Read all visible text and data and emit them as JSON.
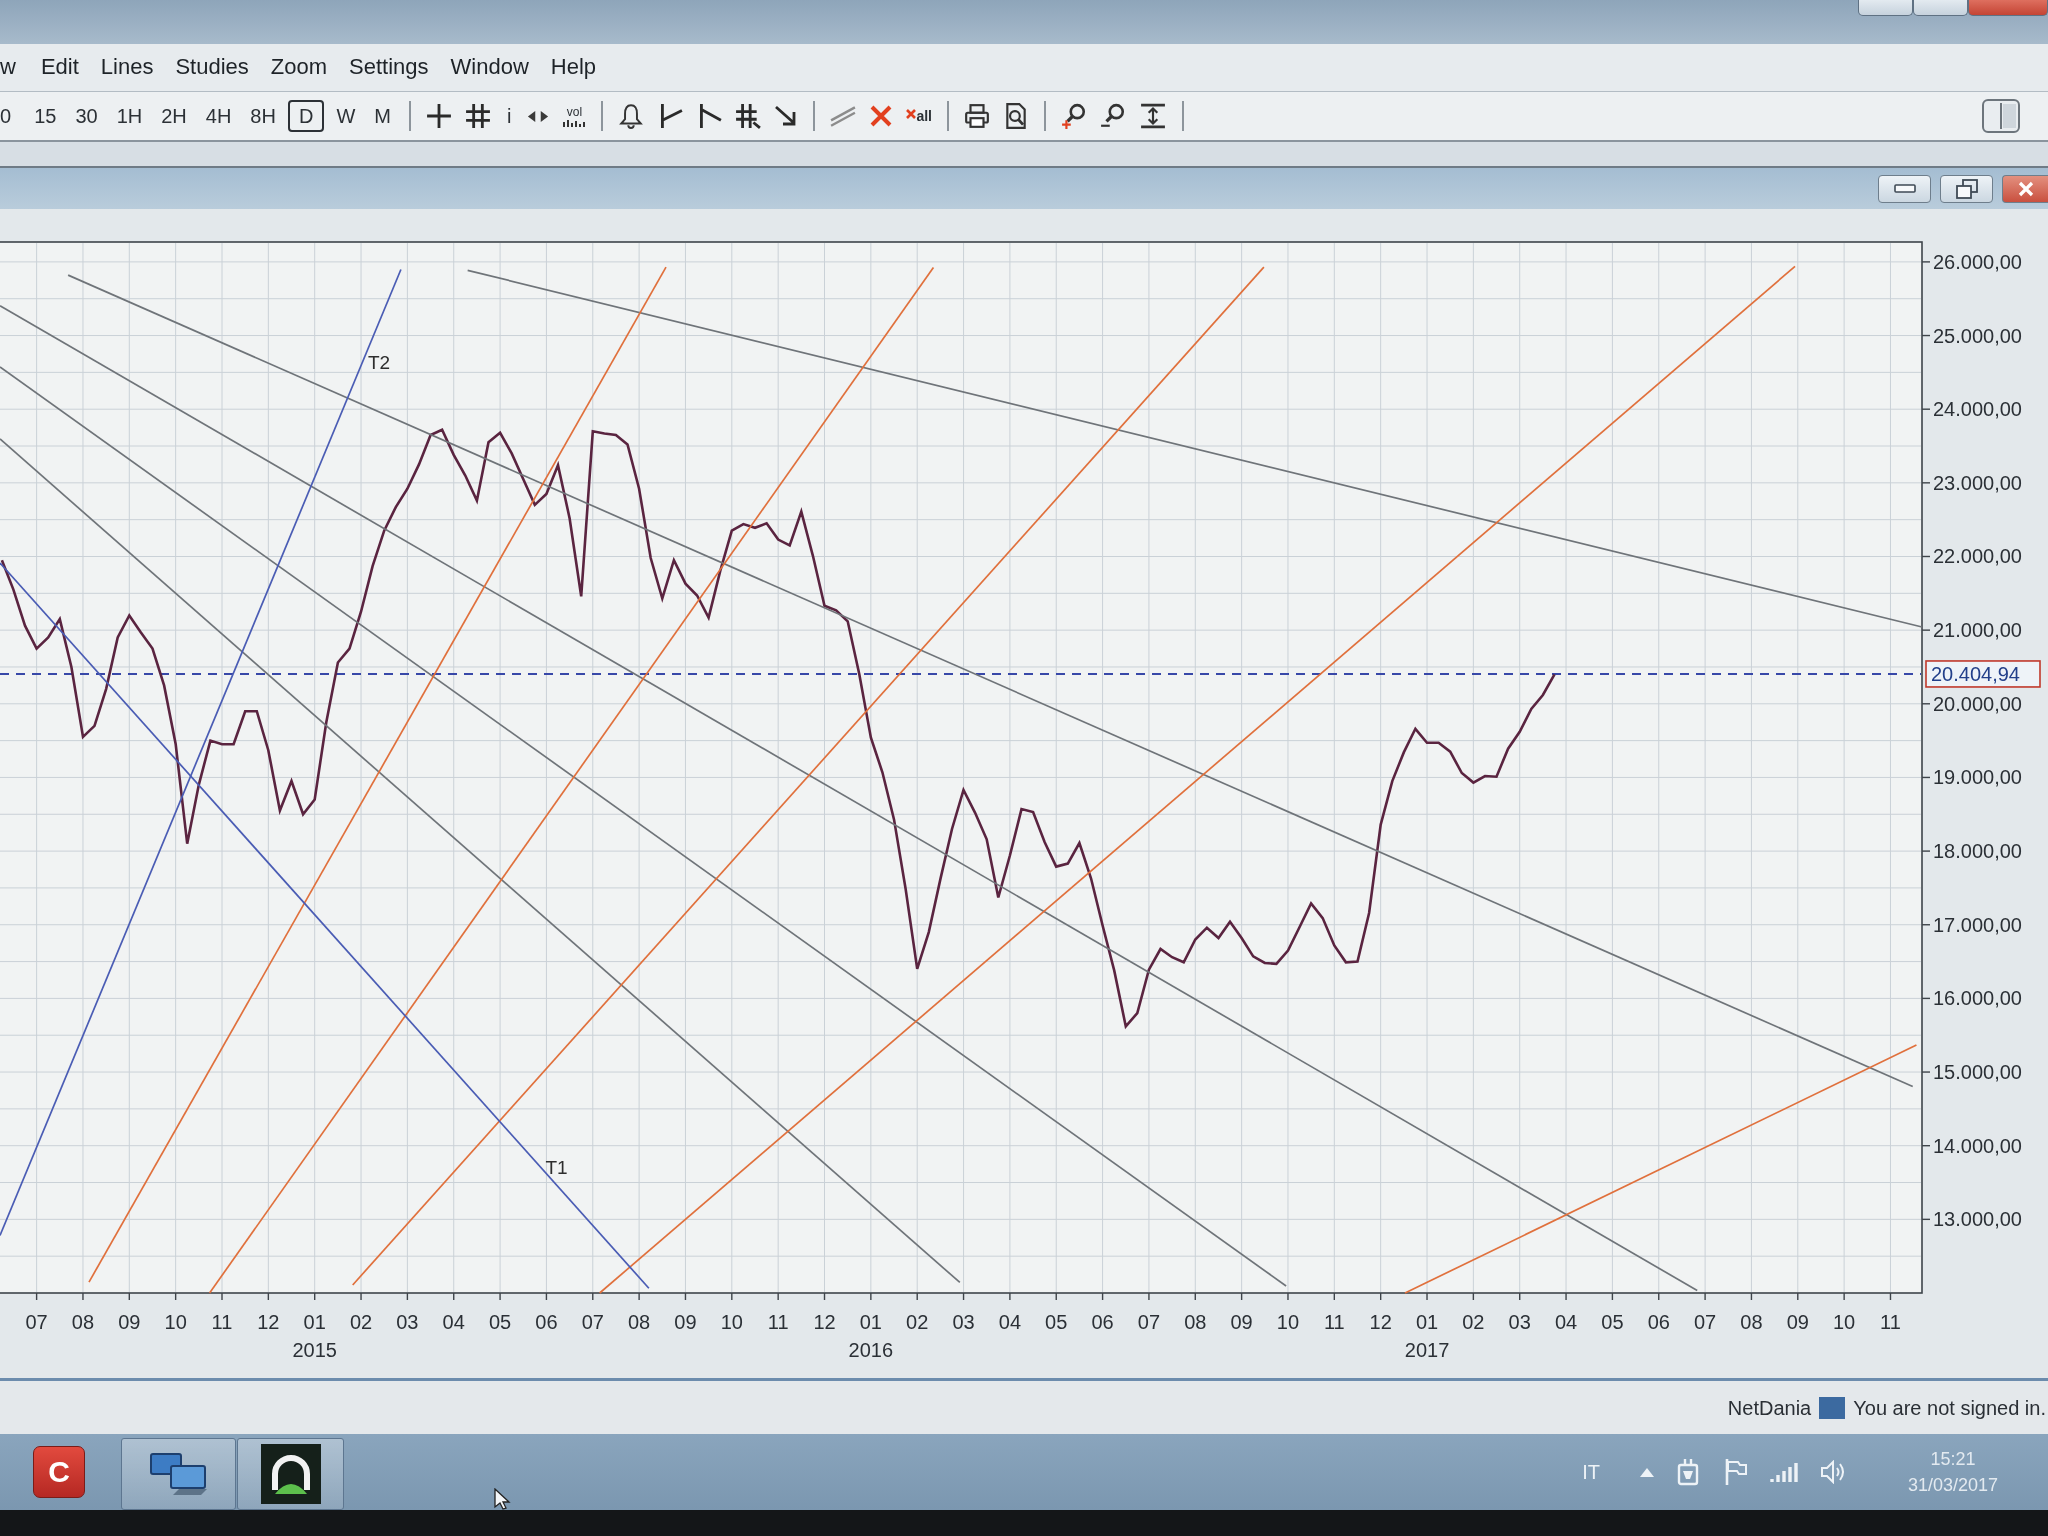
{
  "menu": [
    "w",
    "Edit",
    "Lines",
    "Studies",
    "Zoom",
    "Settings",
    "Window",
    "Help"
  ],
  "toolbar": [
    {
      "kind": "period",
      "label": "0",
      "selected": false
    },
    {
      "kind": "period",
      "label": "15",
      "selected": false
    },
    {
      "kind": "period",
      "label": "30",
      "selected": false
    },
    {
      "kind": "period",
      "label": "1H",
      "selected": false
    },
    {
      "kind": "period",
      "label": "2H",
      "selected": false
    },
    {
      "kind": "period",
      "label": "4H",
      "selected": false
    },
    {
      "kind": "period",
      "label": "8H",
      "selected": false
    },
    {
      "kind": "period",
      "label": "D",
      "selected": true
    },
    {
      "kind": "period",
      "label": "W",
      "selected": false
    },
    {
      "kind": "period",
      "label": "M",
      "selected": false
    },
    {
      "kind": "separator"
    },
    {
      "kind": "crosshair"
    },
    {
      "kind": "hash"
    },
    {
      "kind": "info",
      "label": "i"
    },
    {
      "kind": "arrows"
    },
    {
      "kind": "volume",
      "label": "vol"
    },
    {
      "kind": "separator"
    },
    {
      "kind": "bell"
    },
    {
      "kind": "rising-line"
    },
    {
      "kind": "falling-line"
    },
    {
      "kind": "hash-line"
    },
    {
      "kind": "arrow"
    },
    {
      "kind": "separator"
    },
    {
      "kind": "parallel"
    },
    {
      "kind": "delete"
    },
    {
      "kind": "delete-all",
      "label": "all"
    },
    {
      "kind": "separator"
    },
    {
      "kind": "print"
    },
    {
      "kind": "preview"
    },
    {
      "kind": "separator"
    },
    {
      "kind": "zoom-in"
    },
    {
      "kind": "zoom-out"
    },
    {
      "kind": "fit"
    },
    {
      "kind": "separator"
    },
    {
      "kind": "layout"
    }
  ],
  "chart": {
    "chart_data": {
      "type": "line",
      "categories": [
        null,
        null,
        null,
        "07",
        null,
        null,
        null,
        "08",
        null,
        null,
        null,
        "09",
        null,
        null,
        null,
        "10",
        null,
        null,
        null,
        "11",
        null,
        null,
        null,
        "12",
        null,
        null,
        null,
        "01",
        null,
        null,
        null,
        "02",
        null,
        null,
        null,
        "03",
        null,
        null,
        null,
        "04",
        null,
        null,
        null,
        "05",
        null,
        null,
        null,
        "06",
        null,
        null,
        null,
        "07",
        null,
        null,
        null,
        "08",
        null,
        null,
        null,
        "09",
        null,
        null,
        null,
        "10",
        null,
        null,
        null,
        "11",
        null,
        null,
        null,
        "12",
        null,
        null,
        null,
        "01",
        null,
        null,
        null,
        "02",
        null,
        null,
        null,
        "03",
        null,
        null,
        null,
        "04",
        null,
        null,
        null,
        "05",
        null,
        null,
        null,
        "06",
        null,
        null,
        null,
        "07",
        null,
        null,
        null,
        "08",
        null,
        null,
        null,
        "09",
        null,
        null,
        null,
        "10",
        null,
        null,
        null,
        "11",
        null,
        null,
        null,
        "12",
        null,
        null,
        null,
        "01",
        null,
        null,
        null,
        "02",
        null,
        null,
        null,
        "03",
        null,
        null,
        null,
        "04",
        null,
        null,
        null,
        "05",
        null,
        null,
        null,
        "06",
        null,
        null,
        null,
        "07",
        null,
        null,
        null,
        "08",
        null,
        null,
        null,
        "09",
        null,
        null,
        null,
        "10",
        null,
        null,
        null,
        "11",
        null,
        null
      ],
      "series": [
        {
          "color": "#5a2440",
          "values": [
            21950,
            21550,
            21060,
            20750,
            20900,
            21150,
            20500,
            19550,
            19700,
            20200,
            20900,
            21200,
            20970,
            20750,
            20250,
            19450,
            18100,
            18900,
            19500,
            19450,
            19450,
            19900,
            19900,
            19370,
            18550,
            18950,
            18500,
            18700,
            19750,
            20560,
            20750,
            21250,
            21870,
            22350,
            22670,
            22920,
            23250,
            23650,
            23720,
            23380,
            23100,
            22760,
            23550,
            23680,
            23400,
            23050,
            22700,
            22850,
            23240,
            22520,
            21460,
            23700,
            23670,
            23650,
            23520,
            22920,
            21980,
            21430,
            21950,
            21630,
            21470,
            21170,
            21800,
            22350,
            22440,
            22390,
            22450,
            22230,
            22150,
            22610,
            22010,
            21330,
            21270,
            21120,
            20400,
            19540,
            19070,
            18430,
            17490,
            16400,
            16900,
            17620,
            18300,
            18830,
            18520,
            18160,
            17370,
            17940,
            18570,
            18530,
            18120,
            17790,
            17830,
            18110,
            17630,
            16990,
            16380,
            15620,
            15800,
            16390,
            16670,
            16560,
            16490,
            16800,
            16960,
            16820,
            17040,
            16820,
            16570,
            16480,
            16470,
            16650,
            16970,
            17290,
            17090,
            16720,
            16490,
            16500,
            17160,
            18360,
            18950,
            19340,
            19660,
            19470,
            19470,
            19350,
            19060,
            18930,
            19020,
            19010,
            19390,
            19620,
            19930,
            20120,
            20400,
            null,
            null,
            null,
            null,
            null,
            null,
            null,
            null,
            null,
            null,
            null,
            null,
            null,
            null,
            null,
            null,
            null,
            null,
            null,
            null,
            null,
            null,
            null,
            null,
            null,
            null,
            null,
            null,
            null,
            null,
            null
          ]
        }
      ],
      "ylim": [
        12000,
        26270
      ],
      "yticks": [
        {
          "value": 13000,
          "label": "13.000,00"
        },
        {
          "value": 14000,
          "label": "14.000,00"
        },
        {
          "value": 15000,
          "label": "15.000,00"
        },
        {
          "value": 16000,
          "label": "16.000,00"
        },
        {
          "value": 17000,
          "label": "17.000,00"
        },
        {
          "value": 18000,
          "label": "18.000,00"
        },
        {
          "value": 19000,
          "label": "19.000,00"
        },
        {
          "value": 20000,
          "label": "20.000,00"
        },
        {
          "value": 21000,
          "label": "21.000,00"
        },
        {
          "value": 22000,
          "label": "22.000,00"
        },
        {
          "value": 23000,
          "label": "23.000,00"
        },
        {
          "value": 24000,
          "label": "24.000,00"
        },
        {
          "value": 25000,
          "label": "25.000,00"
        },
        {
          "value": 26000,
          "label": "26.000,00"
        }
      ],
      "grid": true,
      "ref_lines": [
        {
          "axis": "y",
          "value": 20404.94,
          "label": "20.404,94"
        }
      ]
    },
    "trend_lines": [
      {
        "kind": "fan-down"
      },
      {
        "kind": "fan-down"
      },
      {
        "kind": "fan-down"
      },
      {
        "kind": "fan-down"
      },
      {
        "kind": "fan-down"
      },
      {
        "kind": "fan-up"
      },
      {
        "kind": "fan-up"
      },
      {
        "kind": "fan-up"
      },
      {
        "kind": "fan-up"
      },
      {
        "kind": "fan-up"
      },
      {
        "kind": "trendline",
        "label": "T2"
      },
      {
        "kind": "trendline",
        "label": "T1"
      }
    ],
    "year_labels": [
      "2015",
      "2016",
      "2017"
    ]
  },
  "status_bar": {
    "brand": "NetDania",
    "message": "You are not signed in."
  },
  "taskbar": {
    "apps": [
      {
        "kind": "letter",
        "label": "C"
      },
      {
        "kind": "network"
      },
      {
        "kind": "gauge"
      }
    ],
    "language": "IT",
    "time": "15:21",
    "date": "31/03/2017"
  }
}
